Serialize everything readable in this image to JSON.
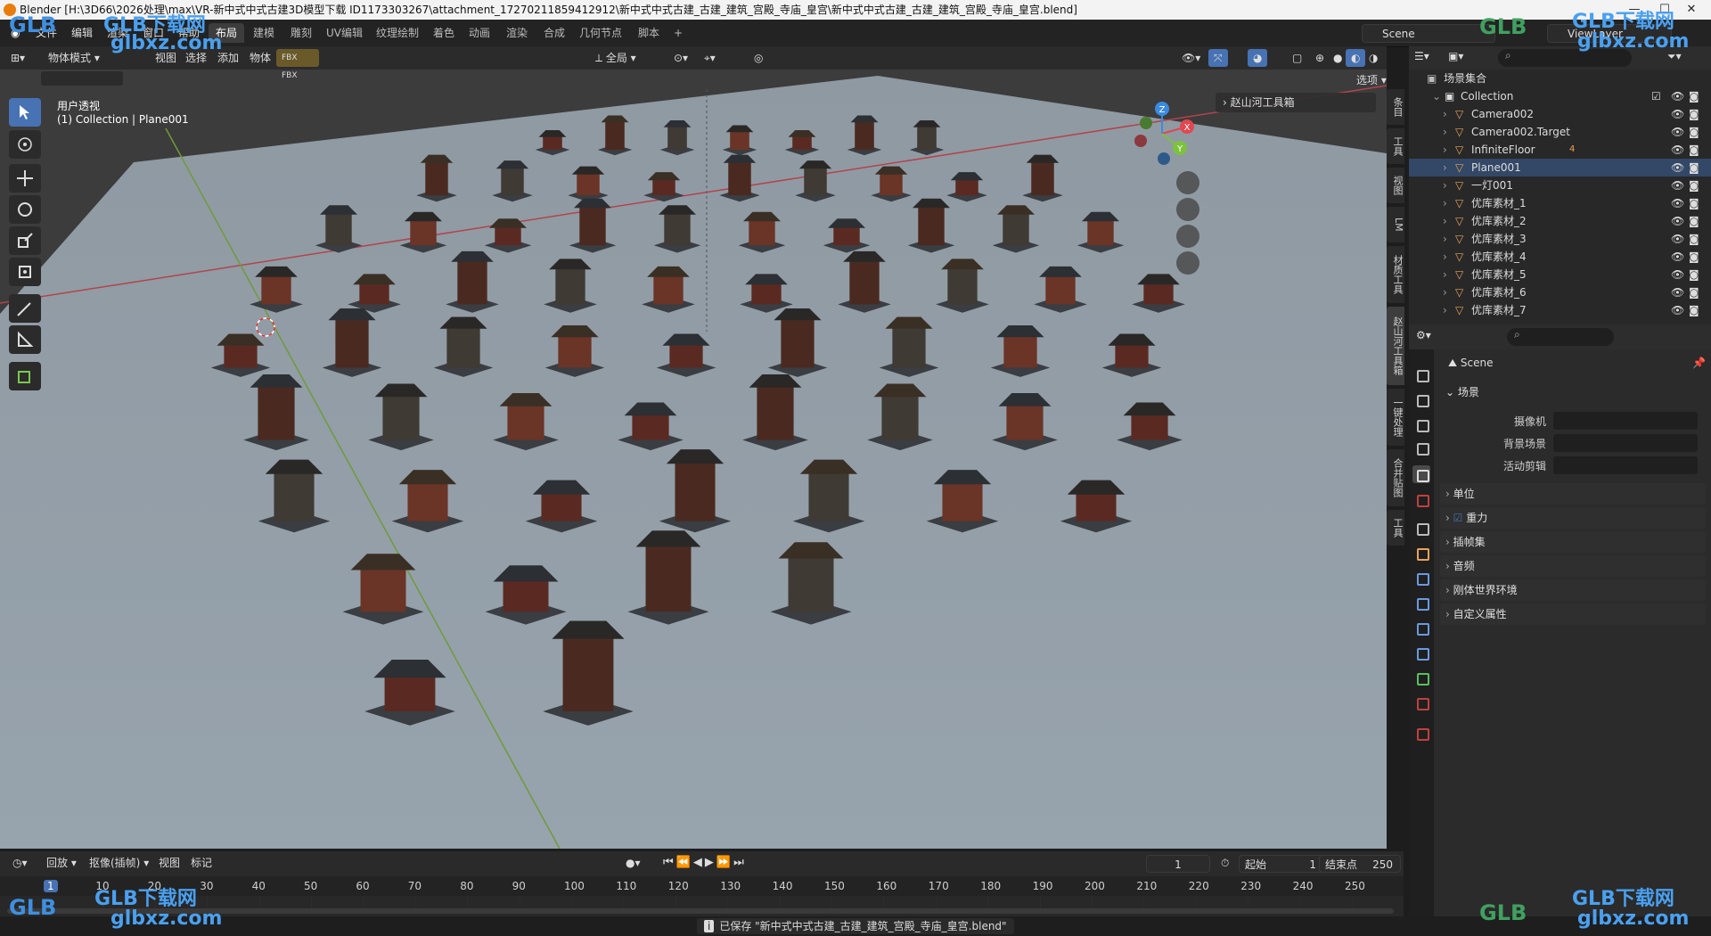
{
  "window": {
    "title": "Blender [H:\\3D66\\2026处理\\max\\VR-新中式中式古建3D模型下载 ID1173303267\\attachment_17270211859412912\\新中式中式古建_古建_建筑_宫殿_寺庙_皇宫\\新中式中式古建_古建_建筑_宫殿_寺庙_皇宫.blend]",
    "minimize": "—",
    "maximize": "☐",
    "close": "✕"
  },
  "menu": [
    "文件",
    "编辑",
    "渲染",
    "窗口",
    "帮助"
  ],
  "workspaces": [
    "布局",
    "建模",
    "雕刻",
    "UV编辑",
    "纹理绘制",
    "着色",
    "动画",
    "渲染",
    "合成",
    "几何节点",
    "脚本",
    "+"
  ],
  "active_workspace": "布局",
  "scene_field": "Scene",
  "viewlayer_field": "ViewLayer",
  "viewport_header": {
    "mode": "物体模式",
    "items": [
      "视图",
      "选择",
      "添加",
      "物体"
    ],
    "orientation": "全局",
    "options": "选项"
  },
  "viewport_overlay": {
    "line1": "用户透视",
    "line2": "(1) Collection | Plane001",
    "addon_panel": "赵山河工具箱"
  },
  "npanel_tabs": [
    "条目",
    "工具",
    "视图",
    "LM",
    "材质工具",
    "赵山河工具箱",
    "一键处理",
    "合并贴图",
    "工具"
  ],
  "gizmo": {
    "x": "X",
    "y": "Y",
    "z": "Z",
    "colors": {
      "x": "#e0474f",
      "y": "#7cc23e",
      "z": "#3a8be0"
    }
  },
  "outliner": {
    "root": "场景集合",
    "rows": [
      {
        "name": "Collection",
        "level": 1
      },
      {
        "name": "Camera002",
        "level": 2
      },
      {
        "name": "Camera002.Target",
        "level": 2
      },
      {
        "name": "InfiniteFloor",
        "level": 2,
        "badge": "4"
      },
      {
        "name": "Plane001",
        "level": 2
      },
      {
        "name": "一灯001",
        "level": 2
      },
      {
        "name": "优库素材_1",
        "level": 2
      },
      {
        "name": "优库素材_2",
        "level": 2
      },
      {
        "name": "优库素材_3",
        "level": 2
      },
      {
        "name": "优库素材_4",
        "level": 2
      },
      {
        "name": "优库素材_5",
        "level": 2
      },
      {
        "name": "优库素材_6",
        "level": 2
      },
      {
        "name": "优库素材_7",
        "level": 2
      }
    ]
  },
  "properties": {
    "title": "Scene",
    "section": "场景",
    "fields": [
      "摄像机",
      "背景场景",
      "活动剪辑"
    ],
    "panels": [
      "单位",
      "重力",
      "插帧集",
      "音频",
      "刚体世界环境",
      "自定义属性"
    ]
  },
  "timeline": {
    "menu": [
      "回放",
      "抠像(插帧)",
      "视图",
      "标记"
    ],
    "current_frame": "1",
    "start_label": "起始",
    "start": "1",
    "end_label": "结束点",
    "end": "250",
    "ticks": [
      "1",
      "10",
      "20",
      "30",
      "40",
      "50",
      "60",
      "70",
      "80",
      "90",
      "100",
      "110",
      "120",
      "130",
      "140",
      "150",
      "160",
      "170",
      "180",
      "190",
      "200",
      "210",
      "220",
      "230",
      "240",
      "250"
    ]
  },
  "status": {
    "message": "已保存 \"新中式中式古建_古建_建筑_宫殿_寺庙_皇宫.blend\""
  },
  "watermarks": {
    "brand": "GLB下载网",
    "url": "glbxz.com",
    "short": "GLB"
  },
  "colors": {
    "accent": "#4772b3",
    "floor": "#8a9aa8",
    "bg": "#3d3d3d"
  }
}
